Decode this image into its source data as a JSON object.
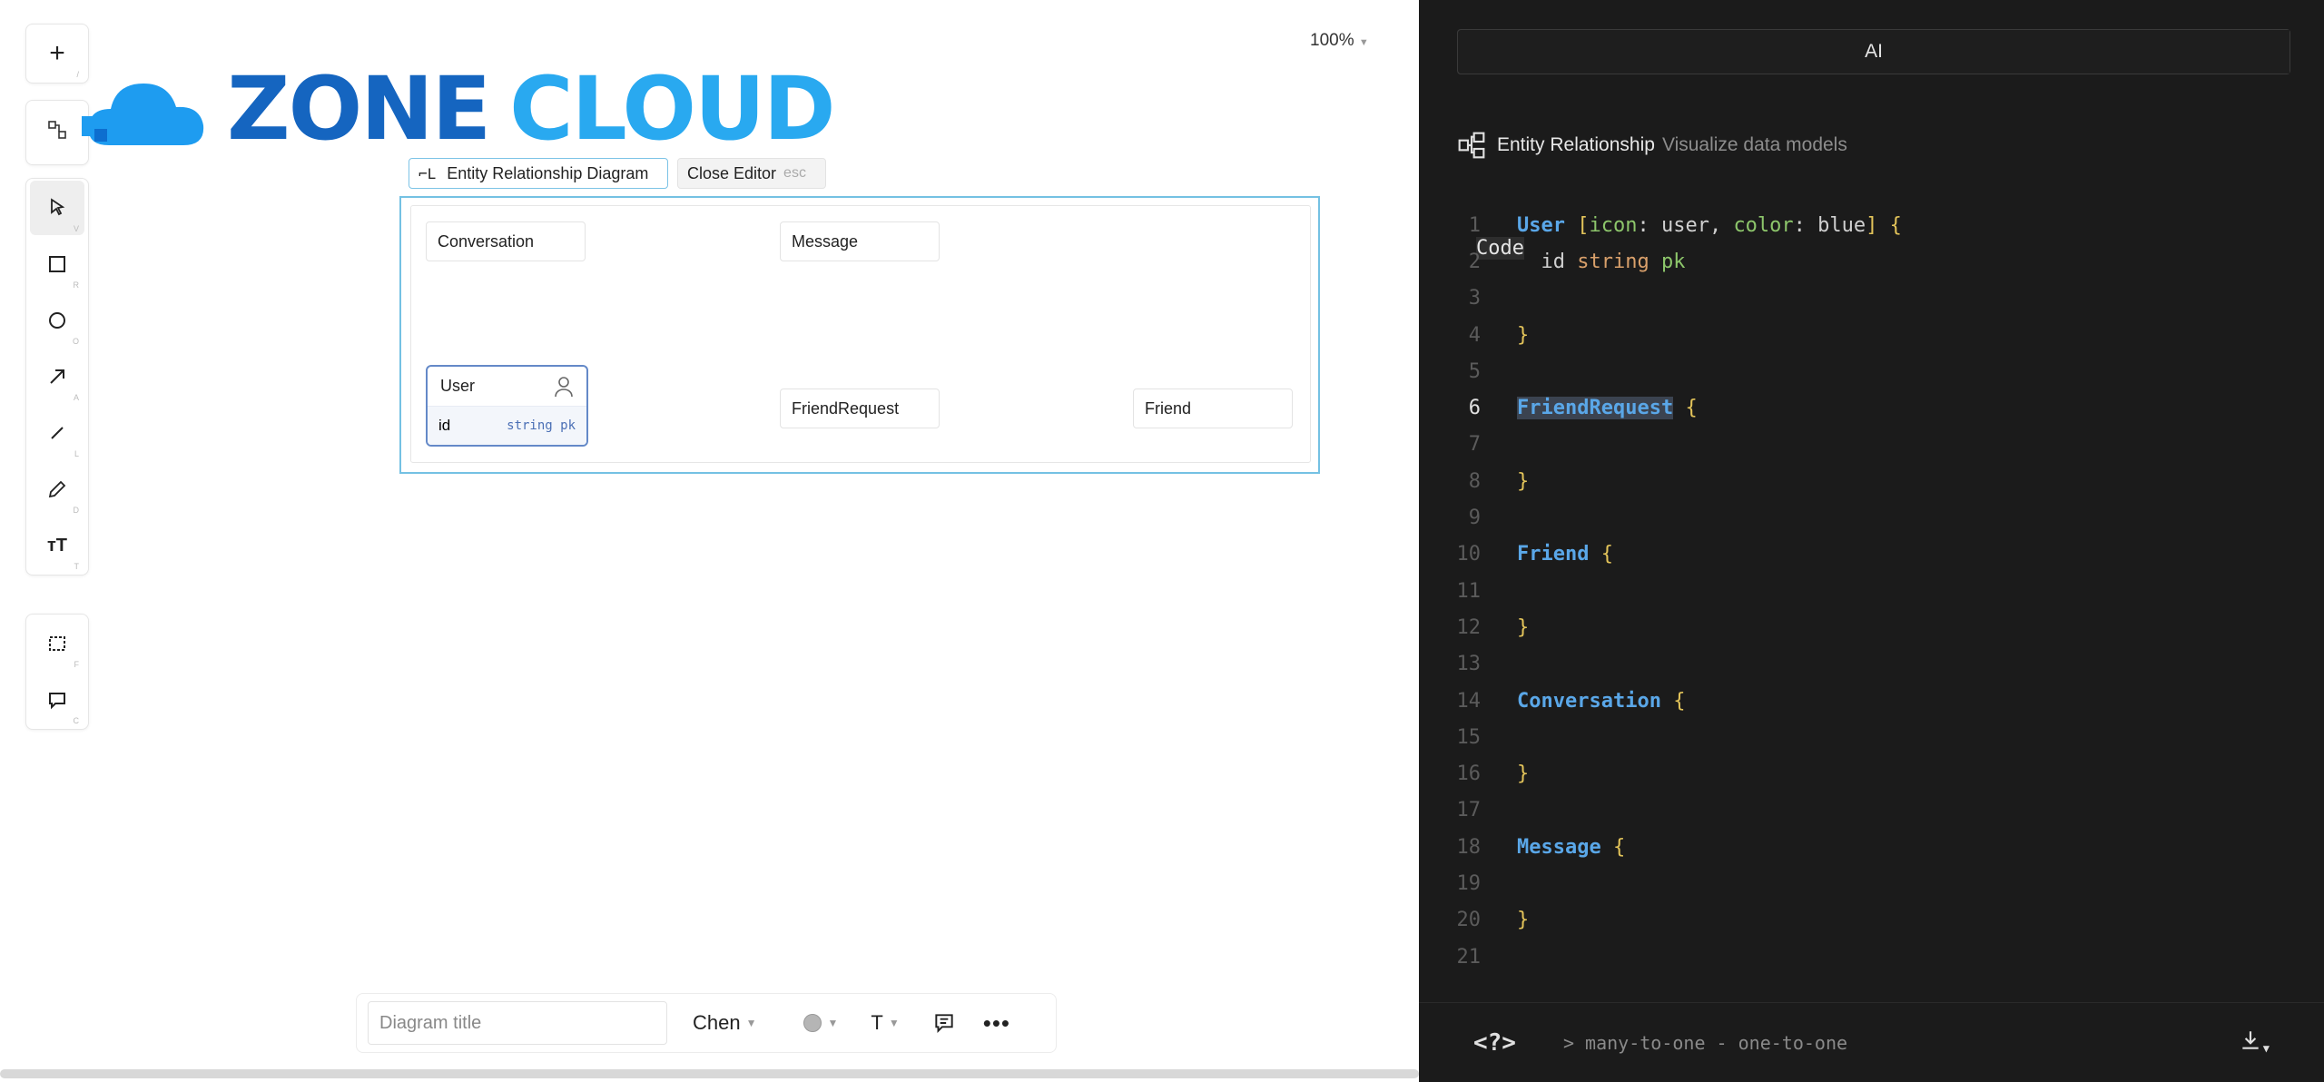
{
  "canvas": {
    "zoom_label": "100%",
    "logo": {
      "word1": "ZONE",
      "word2": "CLOUD"
    },
    "toolbar": {
      "top": [
        {
          "name": "add",
          "glyph": "+",
          "key": "/"
        }
      ],
      "tools": [
        {
          "name": "select",
          "key": "V"
        },
        {
          "name": "rectangle",
          "key": "R"
        },
        {
          "name": "ellipse",
          "key": "O"
        },
        {
          "name": "arrow",
          "key": "A"
        },
        {
          "name": "line",
          "key": "L"
        },
        {
          "name": "pencil",
          "key": "D"
        },
        {
          "name": "text",
          "glyph": "ᴛT",
          "key": "T"
        }
      ],
      "bottom": [
        {
          "name": "frame",
          "key": "F"
        },
        {
          "name": "comment",
          "key": "C"
        }
      ]
    },
    "diagram": {
      "type_label": "Entity Relationship Diagram",
      "close_label": "Close Editor",
      "close_key": "esc",
      "entities": {
        "conversation": "Conversation",
        "message": "Message",
        "user": "User",
        "user_field": "id",
        "user_field_type": "string pk",
        "friend_request": "FriendRequest",
        "friend": "Friend"
      }
    },
    "bottom_bar": {
      "title_placeholder": "Diagram title",
      "notation": "Chen",
      "text_style": "T"
    }
  },
  "panel": {
    "tabs": {
      "ai": "AI",
      "code": "Code"
    },
    "header": {
      "title": "Entity Relationship",
      "subtitle": "Visualize data models"
    },
    "code_lines": [
      "User [icon: user, color: blue] {",
      "  id string pk",
      "",
      "}",
      "",
      "FriendRequest {",
      "",
      "}",
      "",
      "Friend {",
      "",
      "}",
      "",
      "Conversation {",
      "",
      "}",
      "",
      "Message {",
      "",
      "}",
      ""
    ],
    "current_line": 6,
    "footer": {
      "help_label": "<?>",
      "hint_text": "> many-to-one - one-to-one"
    }
  }
}
